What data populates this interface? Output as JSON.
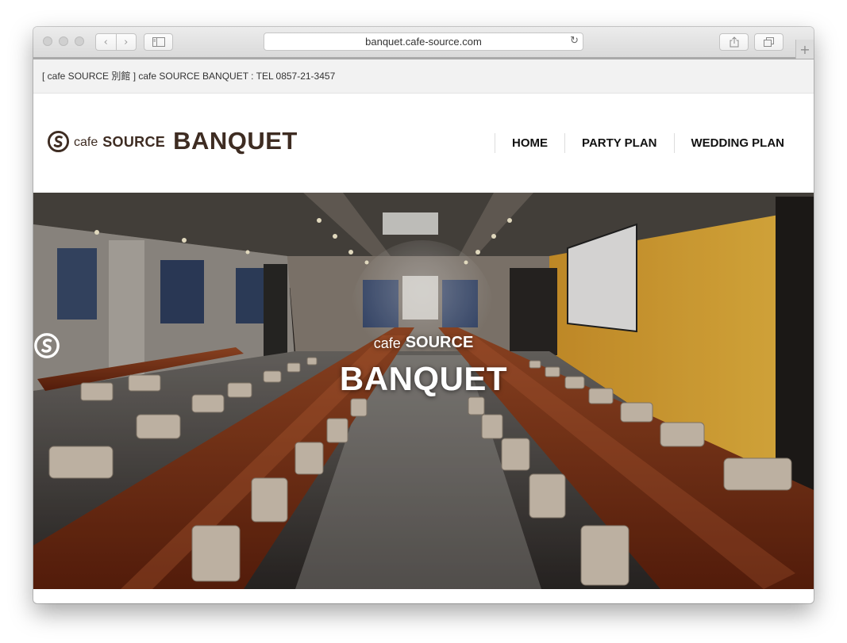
{
  "browser": {
    "url": "banquet.cafe-source.com",
    "icons": {
      "back": "chevron-left-icon",
      "forward": "chevron-right-icon",
      "sidebar": "sidebar-icon",
      "reload": "reload-icon",
      "share": "share-icon",
      "tabs": "tabs-icon",
      "new_tab": "plus-icon"
    },
    "glyphs": {
      "back": "‹",
      "forward": "›",
      "reload": "↻",
      "new_tab": "+"
    }
  },
  "site": {
    "info_bar": "[ cafe SOURCE 別館 ] cafe SOURCE BANQUET : TEL 0857-21-3457",
    "logo": {
      "cafe": "cafe",
      "source": "SOURCE",
      "banquet": "BANQUET"
    },
    "nav": [
      {
        "label": "HOME"
      },
      {
        "label": "PARTY PLAN"
      },
      {
        "label": "WEDDING PLAN"
      }
    ],
    "hero": {
      "cafe": "cafe",
      "source": "SOURCE",
      "banquet": "BANQUET"
    },
    "colors": {
      "brand_brown": "#3e2c22",
      "wall_yellow": "#e9b53a",
      "table_wood": "#8a3a1c"
    }
  }
}
